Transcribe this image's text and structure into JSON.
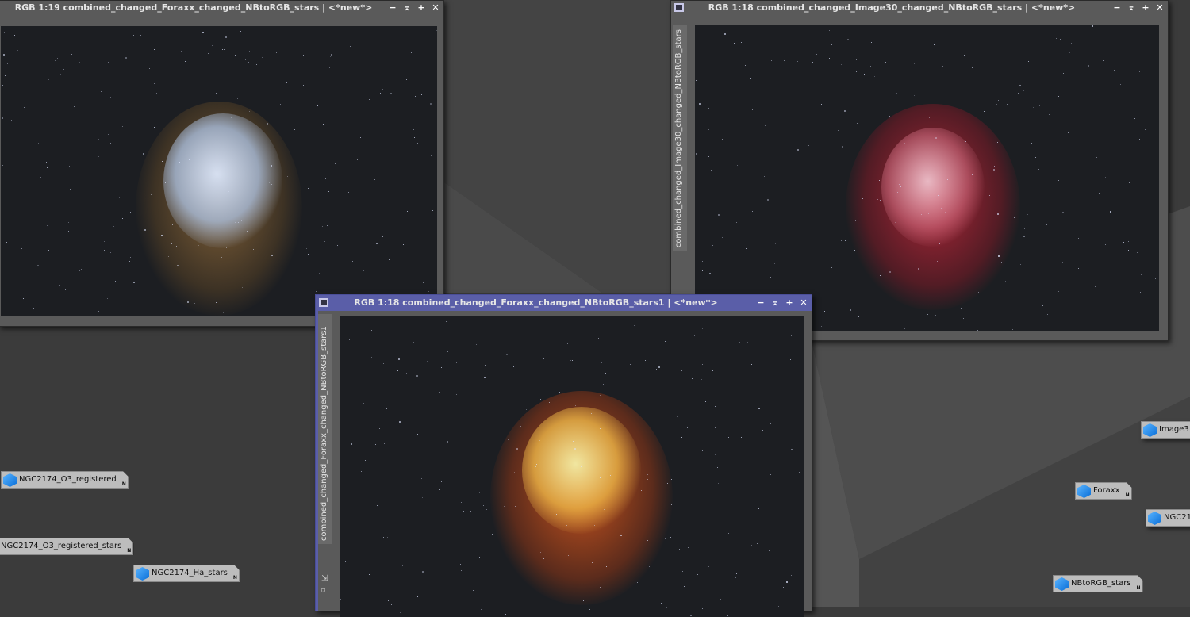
{
  "windows": [
    {
      "title": "RGB 1:19 combined_changed_Foraxx_changed_NBtoRGB_stars | <*new*>",
      "active": false
    },
    {
      "title": "RGB 1:18 combined_changed_Image30_changed_NBtoRGB_stars | <*new*>",
      "tab": "combined_changed_Image30_changed_NBtoRGB_stars",
      "active": false
    },
    {
      "title": "RGB 1:18 combined_changed_Foraxx_changed_NBtoRGB_stars1 | <*new*>",
      "tab": "combined_changed_Foraxx_changed_NBtoRGB_stars1",
      "active": true
    }
  ],
  "window_controls": {
    "minimize": "−",
    "shade": "⌅",
    "maximize": "+",
    "close": "✕"
  },
  "desktop_icons": [
    "NGC2174_O3_registered",
    "NGC2174_O3_registered_stars",
    "NGC2174_Ha_stars",
    "Image3",
    "Foraxx",
    "NGC21",
    "NBtoRGB_stars"
  ],
  "colors": {
    "active_titlebar": "#5a5ea8",
    "inactive_titlebar": "#5a5a5a",
    "desktop": "#3b3b3b"
  }
}
